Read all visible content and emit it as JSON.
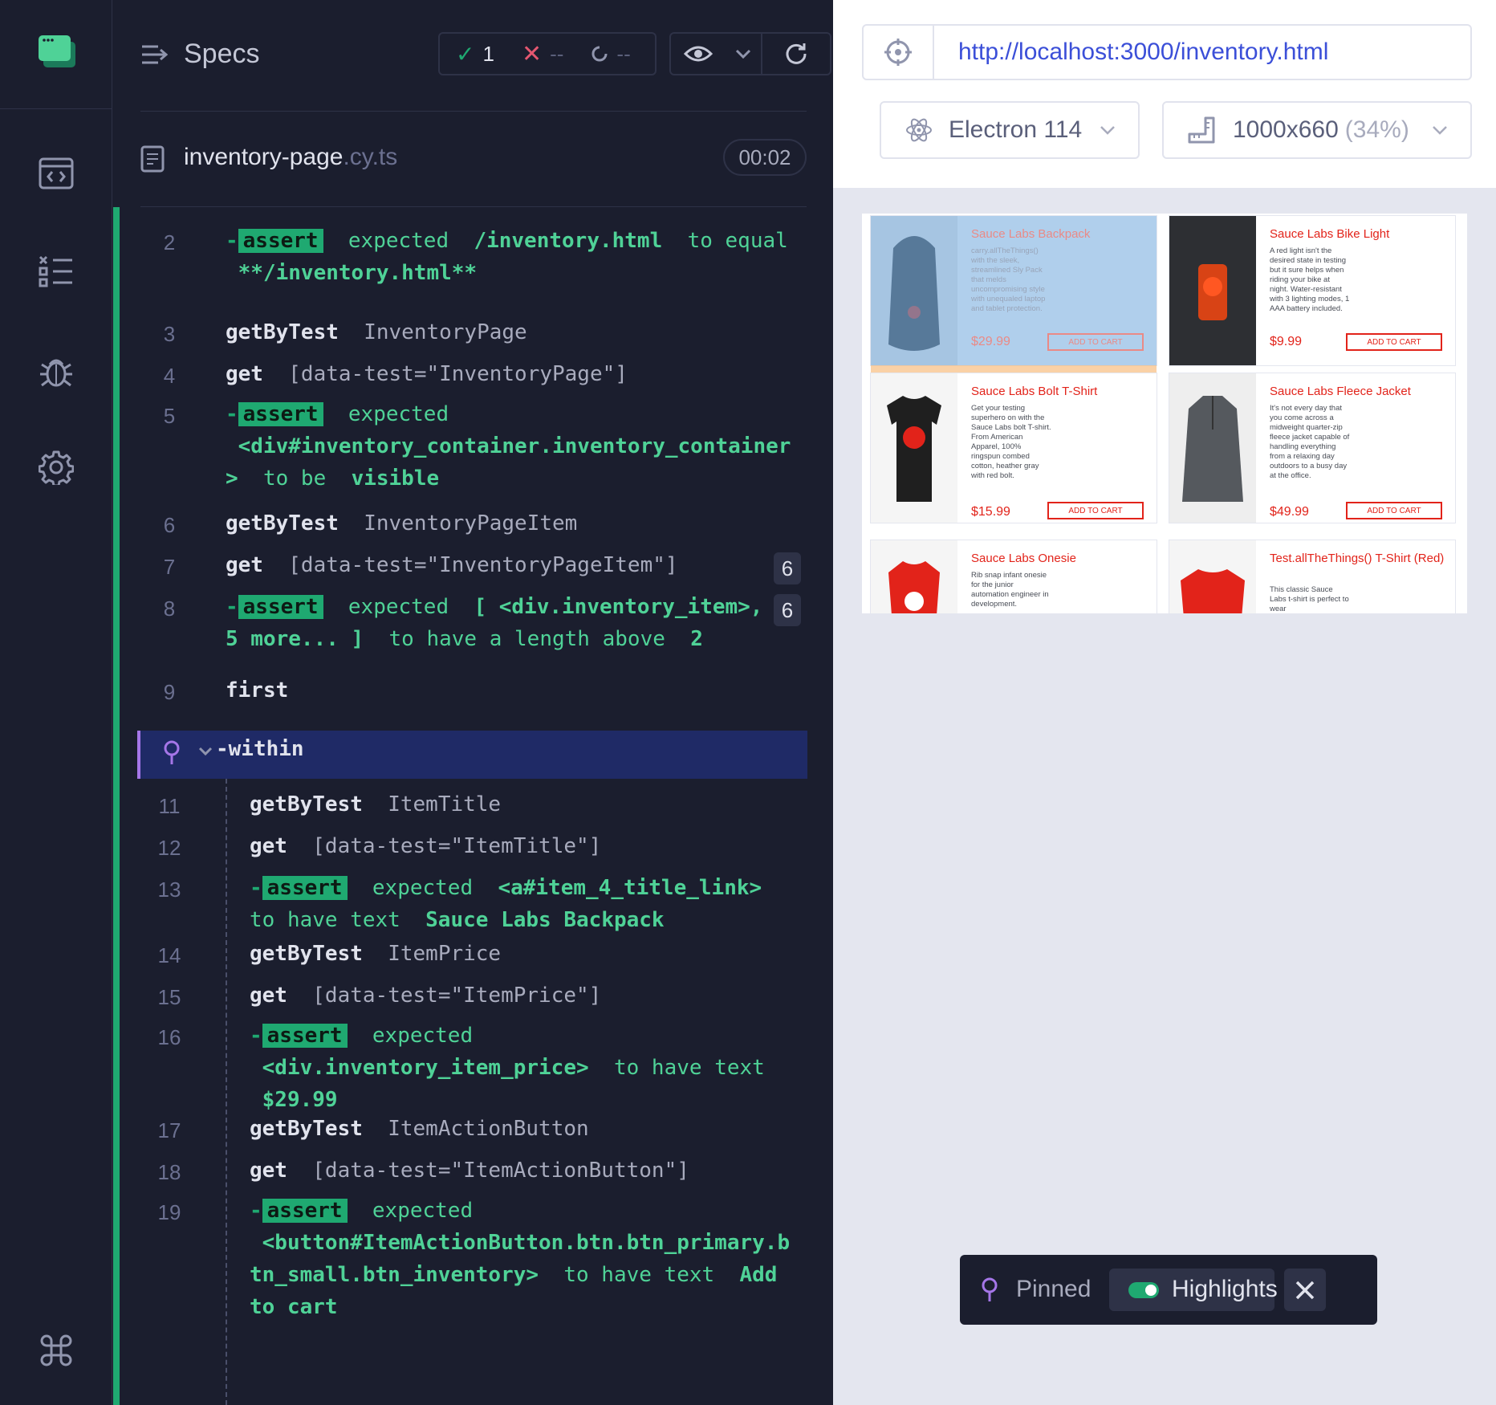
{
  "nav": {
    "items": [
      "app-logo",
      "runs",
      "specs-list",
      "debug",
      "settings"
    ],
    "shortcut_icon": "command-icon"
  },
  "reporter": {
    "header": {
      "title": "Specs",
      "passed": "1",
      "failed": "--",
      "pending": "--"
    },
    "spec": {
      "name": "inventory-page",
      "ext": ".cy.ts",
      "duration": "00:02"
    },
    "commands": [
      {
        "line": "2",
        "type": "assert",
        "parts": [
          "expected",
          "/inventory.html",
          "to equal",
          "**/inventory.html**"
        ]
      },
      {
        "line": "3",
        "cmd": "getByTest",
        "arg": "InventoryPage"
      },
      {
        "line": "4",
        "cmd": "get",
        "arg": "[data-test=\"InventoryPage\"]"
      },
      {
        "line": "5",
        "type": "assert",
        "parts": [
          "expected",
          "<div#inventory_container.inventory_container",
          ">",
          "to be",
          "visible"
        ]
      },
      {
        "line": "6",
        "cmd": "getByTest",
        "arg": "InventoryPageItem"
      },
      {
        "line": "7",
        "cmd": "get",
        "arg": "[data-test=\"InventoryPageItem\"]",
        "count": "6"
      },
      {
        "line": "8",
        "type": "assert",
        "parts": [
          "expected",
          "[ <div.inventory_item>,",
          "5 more... ]",
          "to have a length above",
          "2"
        ],
        "count": "6"
      },
      {
        "line": "9",
        "cmd": "first",
        "arg": ""
      },
      {
        "line": "",
        "cmd": "-within",
        "arg": ""
      },
      {
        "line": "11",
        "cmd": "getByTest",
        "arg": "ItemTitle"
      },
      {
        "line": "12",
        "cmd": "get",
        "arg": "[data-test=\"ItemTitle\"]"
      },
      {
        "line": "13",
        "type": "assert",
        "parts": [
          "expected",
          "<a#item_4_title_link>",
          "to have text",
          "Sauce Labs Backpack"
        ]
      },
      {
        "line": "14",
        "cmd": "getByTest",
        "arg": "ItemPrice"
      },
      {
        "line": "15",
        "cmd": "get",
        "arg": "[data-test=\"ItemPrice\"]"
      },
      {
        "line": "16",
        "type": "assert",
        "parts": [
          "expected",
          "<div.inventory_item_price>",
          "to have text",
          "$29.99"
        ]
      },
      {
        "line": "17",
        "cmd": "getByTest",
        "arg": "ItemActionButton"
      },
      {
        "line": "18",
        "cmd": "get",
        "arg": "[data-test=\"ItemActionButton\"]"
      },
      {
        "line": "19",
        "type": "assert",
        "parts": [
          "expected",
          "<button#ItemActionButton.btn.btn_primary.b",
          "tn_small.btn_inventory>",
          "to have text",
          "Add",
          "to cart"
        ]
      }
    ],
    "assert_label": "assert",
    "dash": "-"
  },
  "aut": {
    "url": "http://localhost:3000/inventory.html",
    "browser": "Electron 114",
    "viewport": "1000x660",
    "viewport_scale": "(34%)",
    "products": [
      {
        "title": "Sauce Labs Backpack",
        "desc": "carry.allTheThings() with the sleek, streamlined Sly Pack that melds uncompromising style with unequaled laptop and tablet protection.",
        "price": "$29.99",
        "button": "ADD TO CART",
        "image": "backpack"
      },
      {
        "title": "Sauce Labs Bike Light",
        "desc": "A red light isn't the desired state in testing but it sure helps when riding your bike at night. Water-resistant with 3 lighting modes, 1 AAA battery included.",
        "price": "$9.99",
        "button": "ADD TO CART",
        "image": "bike-light"
      },
      {
        "title": "Sauce Labs Bolt T-Shirt",
        "desc": "Get your testing superhero on with the Sauce Labs bolt T-shirt. From American Apparel, 100% ringspun combed cotton, heather gray with red bolt.",
        "price": "$15.99",
        "button": "ADD TO CART",
        "image": "bolt-shirt"
      },
      {
        "title": "Sauce Labs Fleece Jacket",
        "desc": "It's not every day that you come across a midweight quarter-zip fleece jacket capable of handling everything from a relaxing day outdoors to a busy day at the office.",
        "price": "$49.99",
        "button": "ADD TO CART",
        "image": "fleece-jacket"
      },
      {
        "title": "Sauce Labs Onesie",
        "desc": "Rib snap infant onesie for the junior automation engineer in development.",
        "price": "",
        "button": "",
        "image": "onesie"
      },
      {
        "title": "Test.allTheThings() T-Shirt (Red)",
        "desc": "This classic Sauce Labs t-shirt is perfect to wear",
        "price": "",
        "button": "",
        "image": "red-shirt"
      }
    ],
    "pinned": {
      "label": "Pinned",
      "toggle_label": "Highlights",
      "toggle_on": true
    }
  }
}
